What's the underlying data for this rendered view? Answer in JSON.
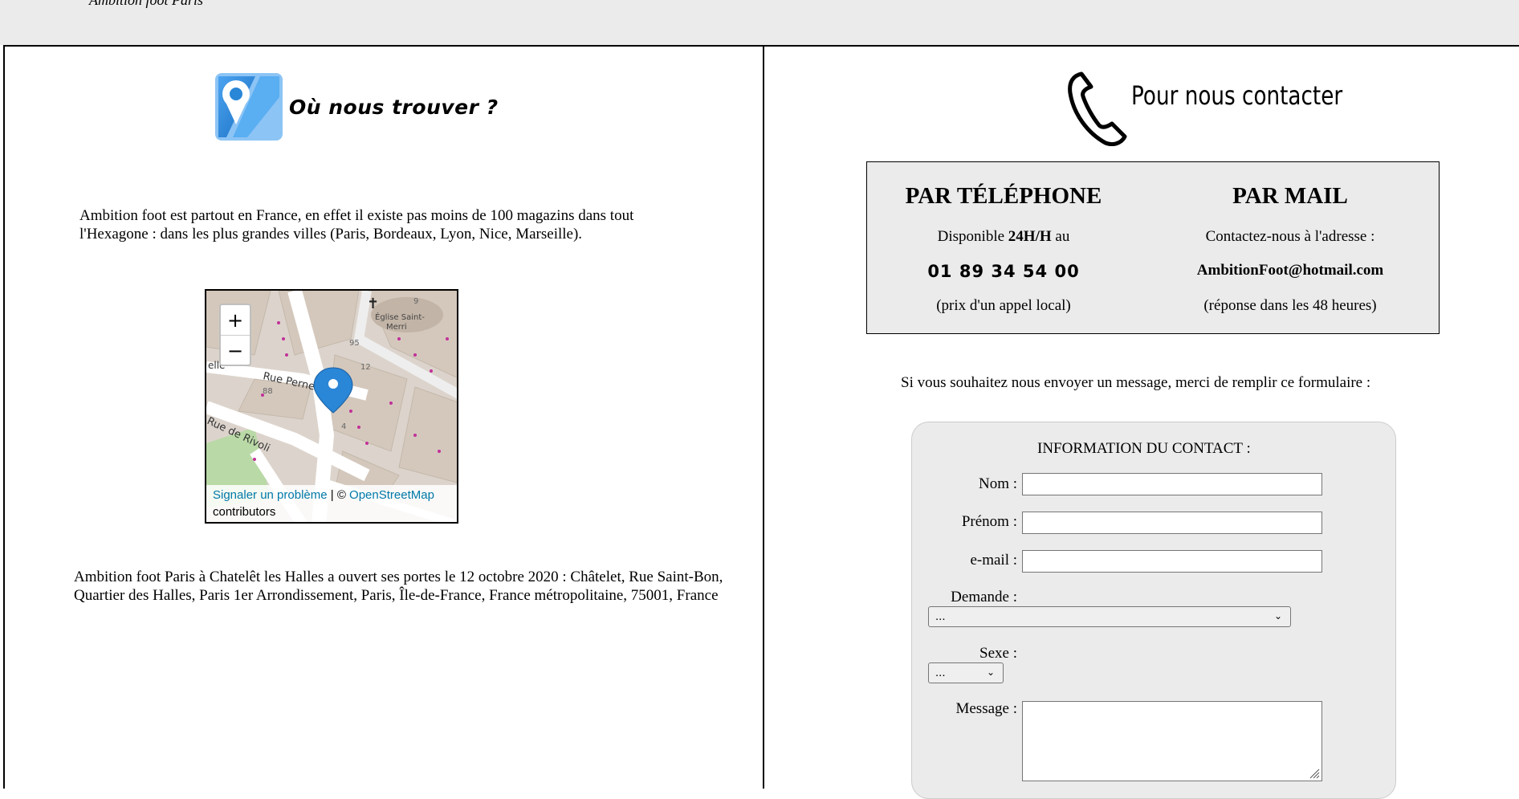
{
  "header": {
    "brand": "Ambition foot Paris"
  },
  "left": {
    "heading": "Où nous trouver ?",
    "intro": "Ambition foot est partout en France, en effet il existe pas moins de 100 magazins dans tout l'Hexagone : dans les plus grandes villes (Paris, Bordeaux, Lyon, Nice, Marseille).",
    "map": {
      "zoom_in": "+",
      "zoom_out": "−",
      "report_link": "Signaler un problème",
      "attr_sep": " | © ",
      "osm_link": "OpenStreetMap",
      "contributors": "contributors",
      "labels": {
        "church": "Église Saint-",
        "church2": "Merri",
        "street1": "Rue Pernelle",
        "street2": "Rue de Rivoli",
        "street3": "elle",
        "n95": "95",
        "n12": "12",
        "n88": "88",
        "n4": "4",
        "n9": "9"
      }
    },
    "address": "Ambition foot Paris à Chatelêt les Halles a ouvert ses portes le 12 octobre 2020 : Châtelet, Rue Saint-Bon, Quartier des Halles, Paris 1er Arrondissement, Paris, Île-de-France, France métropolitaine, 75001, France"
  },
  "right": {
    "heading": "Pour nous contacter",
    "phone": {
      "title": "PAR TÉLÉPHONE",
      "avail_prefix": "Disponible ",
      "avail_bold": "24H/H",
      "avail_suffix": " au",
      "number": "01 89 34 54 00",
      "note": "(prix d'un appel local)"
    },
    "mail": {
      "title": "PAR MAIL",
      "line1": "Contactez-nous à l'adresse :",
      "address": "AmbitionFoot@hotmail.com",
      "note": "(réponse dans les 48 heures)"
    },
    "form_intro": "Si vous souhaitez nous envoyer un message, merci de remplir ce formulaire :",
    "form": {
      "title": "INFORMATION DU CONTACT :",
      "nom_label": "Nom :",
      "prenom_label": "Prénom :",
      "email_label": "e-mail :",
      "demande_label": "Demande :",
      "demande_value": "...",
      "sexe_label": "Sexe :",
      "sexe_value": "...",
      "message_label": "Message :"
    }
  },
  "colors": {
    "map_marker": "#2a86d6",
    "link": "#0078a8",
    "panel_bg": "#ebebeb"
  }
}
